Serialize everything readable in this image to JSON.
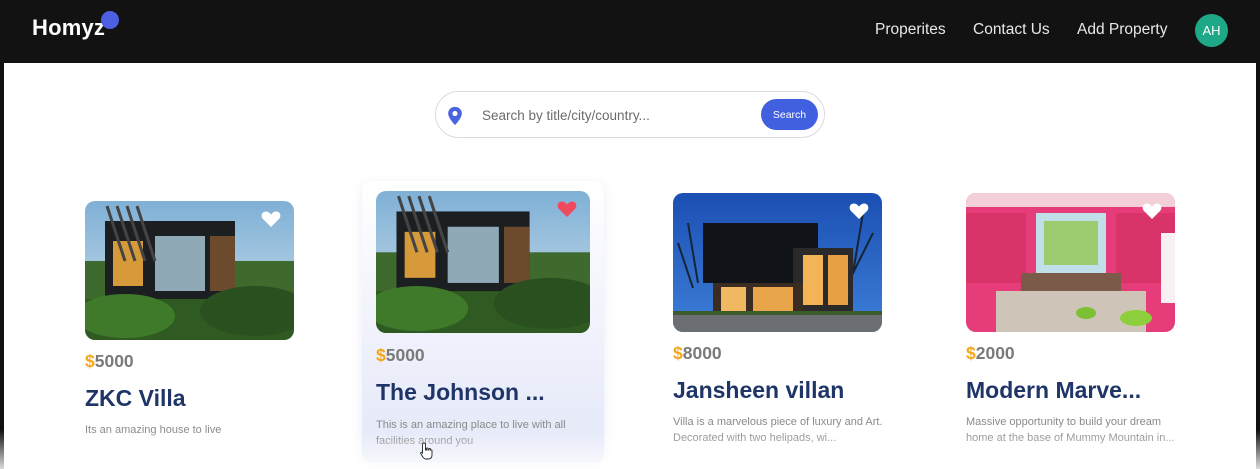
{
  "header": {
    "logo": "Homyz",
    "nav": [
      "Properites",
      "Contact Us",
      "Add Property"
    ],
    "avatar_initials": "AH"
  },
  "search": {
    "placeholder": "Search by title/city/country...",
    "button_label": "Search"
  },
  "properties": [
    {
      "currency": "$",
      "price": "5000",
      "title": "ZKC Villa",
      "description": "Its an amazing house to live",
      "favorited": false
    },
    {
      "currency": "$",
      "price": "5000",
      "title": "The Johnson ...",
      "description": "This is an amazing place to live with all facilities around you",
      "favorited": true
    },
    {
      "currency": "$",
      "price": "8000",
      "title": "Jansheen villan",
      "description": "Villa is a marvelous piece of luxury and Art. Decorated with two helipads, wi...",
      "favorited": false
    },
    {
      "currency": "$",
      "price": "2000",
      "title": "Modern Marve...",
      "description": "Massive opportunity to build your dream home at the base of Mummy Mountain in...",
      "favorited": false
    }
  ],
  "colors": {
    "header_bg": "#121212",
    "accent": "#4160e0",
    "price_dollar": "#f4a51c",
    "title": "#1f3568",
    "heart_favorited": "#f04a5e",
    "avatar": "#1fa887"
  }
}
